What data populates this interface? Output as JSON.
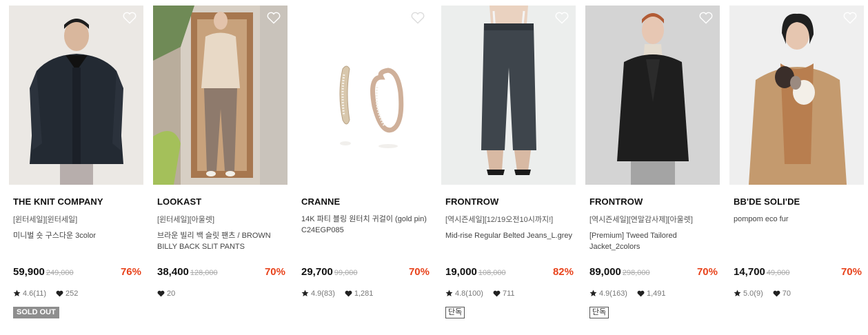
{
  "products": [
    {
      "brand": "THE KNIT COMPANY",
      "tags": "[윈터세일][윈터세일]",
      "name": "미니벌 숏 구스다운 3color",
      "price": "59,900",
      "original_price": "249,000",
      "discount": "76%",
      "rating": "4.6(11)",
      "likes": "252",
      "badge": "SOLD OUT",
      "image_icon": "puffer-jacket-model-image"
    },
    {
      "brand": "LOOKAST",
      "tags": "[윈터세일][아울렛]",
      "name": "브라운 빌리 백 슬릿 팬츠 / BROWN BILLY BACK SLIT PANTS",
      "price": "38,400",
      "original_price": "128,000",
      "discount": "70%",
      "rating": "",
      "likes": "20",
      "badge": "",
      "image_icon": "slit-pants-model-image"
    },
    {
      "brand": "CRANNE",
      "tags": "",
      "name": "14K 파티 블링 원터치 귀걸이 (gold pin) C24EGP085",
      "price": "29,700",
      "original_price": "99,000",
      "discount": "70%",
      "rating": "4.9(83)",
      "likes": "1,281",
      "badge": "",
      "image_icon": "hoop-earrings-image"
    },
    {
      "brand": "FRONTROW",
      "tags": "[역시즌세일][12/19오전10시까지!]",
      "name": "Mid-rise Regular Belted Jeans_L.grey",
      "price": "19,000",
      "original_price": "108,000",
      "discount": "82%",
      "rating": "4.8(100)",
      "likes": "711",
      "badge": "단독",
      "image_icon": "jeans-model-image"
    },
    {
      "brand": "FRONTROW",
      "tags": "[역시즌세일][연말감사제][아울렛]",
      "name": "[Premium] Tweed Tailored Jacket_2colors",
      "price": "89,000",
      "original_price": "298,000",
      "discount": "70%",
      "rating": "4.9(163)",
      "likes": "1,491",
      "badge": "단독",
      "image_icon": "tweed-jacket-model-image"
    },
    {
      "brand": "BB'DE SOLI'DE",
      "tags": "",
      "name": "pompom eco fur",
      "price": "14,700",
      "original_price": "49,000",
      "discount": "70%",
      "rating": "5.0(9)",
      "likes": "70",
      "badge": "",
      "image_icon": "fur-scarf-model-image"
    }
  ],
  "colors": {
    "discount": "#e8431c",
    "brand_text": "#111111",
    "sold_out_badge": "#8e8e8e"
  },
  "icons": {
    "wishlist": "heart-outline-icon",
    "rating": "star-icon",
    "likes": "heart-filled-icon"
  }
}
